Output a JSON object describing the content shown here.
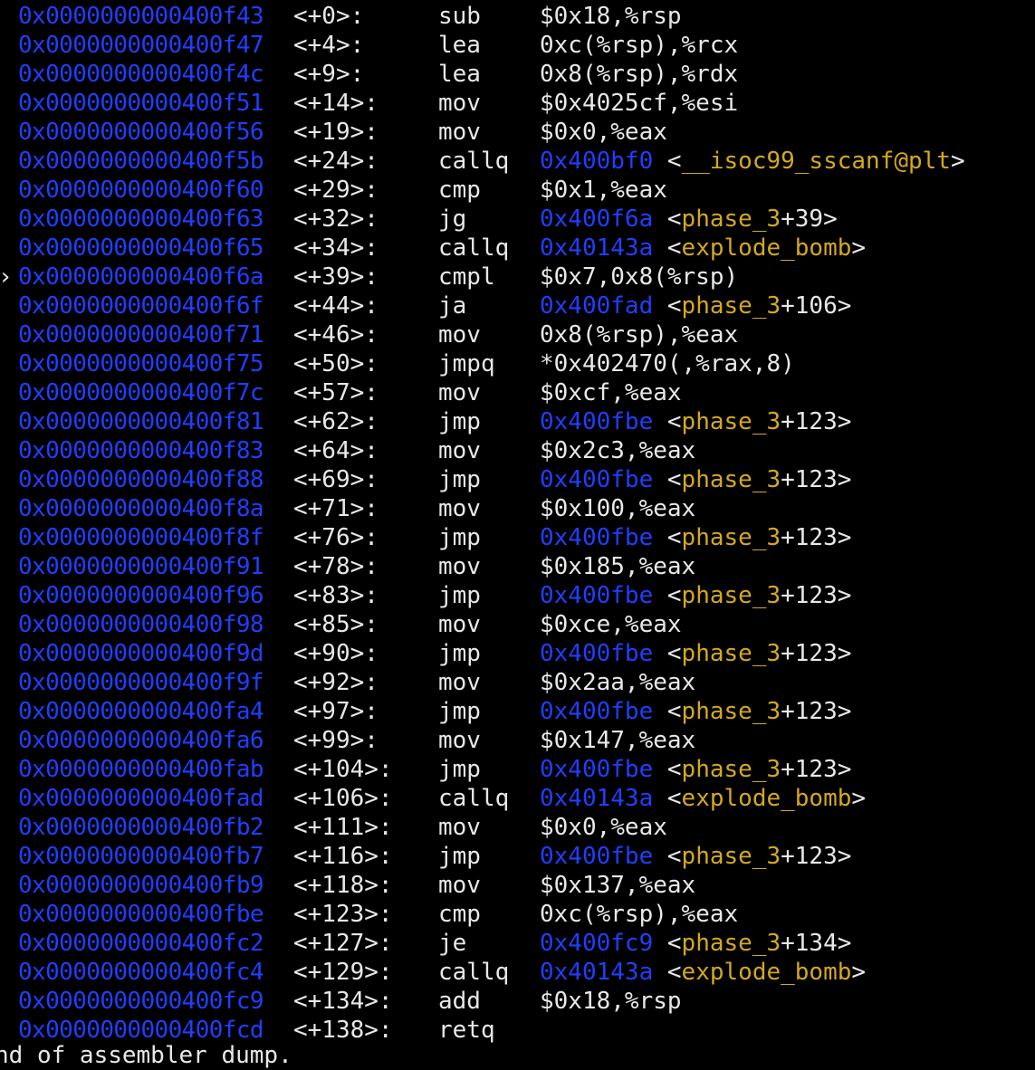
{
  "terminal": {
    "colors": {
      "background": "#000000",
      "text": "#e8e8e8",
      "address": "#1f3fff",
      "symbol": "#d4a820"
    },
    "current_marker": "›",
    "lines": [
      {
        "addr": "0x0000000000400f43",
        "off": "<+0>:",
        "mn": "sub",
        "ops": "$0x18,%rsp"
      },
      {
        "addr": "0x0000000000400f47",
        "off": "<+4>:",
        "mn": "lea",
        "ops": "0xc(%rsp),%rcx"
      },
      {
        "addr": "0x0000000000400f4c",
        "off": "<+9>:",
        "mn": "lea",
        "ops": "0x8(%rsp),%rdx"
      },
      {
        "addr": "0x0000000000400f51",
        "off": "<+14>:",
        "mn": "mov",
        "ops": "$0x4025cf,%esi"
      },
      {
        "addr": "0x0000000000400f56",
        "off": "<+19>:",
        "mn": "mov",
        "ops": "$0x0,%eax"
      },
      {
        "addr": "0x0000000000400f5b",
        "off": "<+24>:",
        "mn": "callq",
        "target": "0x400bf0",
        "sym_open": "<",
        "sym": "__isoc99_sscanf@plt",
        "sym_suffix": ">"
      },
      {
        "addr": "0x0000000000400f60",
        "off": "<+29>:",
        "mn": "cmp",
        "ops": "$0x1,%eax"
      },
      {
        "addr": "0x0000000000400f63",
        "off": "<+32>:",
        "mn": "jg",
        "target": "0x400f6a",
        "sym_open": "<",
        "sym": "phase_3",
        "sym_suffix": "+39>"
      },
      {
        "addr": "0x0000000000400f65",
        "off": "<+34>:",
        "mn": "callq",
        "target": "0x40143a",
        "sym_open": "<",
        "sym": "explode_bomb",
        "sym_suffix": ">"
      },
      {
        "addr": "0x0000000000400f6a",
        "off": "<+39>:",
        "mn": "cmpl",
        "ops": "$0x7,0x8(%rsp)",
        "current": true
      },
      {
        "addr": "0x0000000000400f6f",
        "off": "<+44>:",
        "mn": "ja",
        "target": "0x400fad",
        "sym_open": "<",
        "sym": "phase_3",
        "sym_suffix": "+106>"
      },
      {
        "addr": "0x0000000000400f71",
        "off": "<+46>:",
        "mn": "mov",
        "ops": "0x8(%rsp),%eax"
      },
      {
        "addr": "0x0000000000400f75",
        "off": "<+50>:",
        "mn": "jmpq",
        "ops": "*0x402470(,%rax,8)"
      },
      {
        "addr": "0x0000000000400f7c",
        "off": "<+57>:",
        "mn": "mov",
        "ops": "$0xcf,%eax"
      },
      {
        "addr": "0x0000000000400f81",
        "off": "<+62>:",
        "mn": "jmp",
        "target": "0x400fbe",
        "sym_open": "<",
        "sym": "phase_3",
        "sym_suffix": "+123>"
      },
      {
        "addr": "0x0000000000400f83",
        "off": "<+64>:",
        "mn": "mov",
        "ops": "$0x2c3,%eax"
      },
      {
        "addr": "0x0000000000400f88",
        "off": "<+69>:",
        "mn": "jmp",
        "target": "0x400fbe",
        "sym_open": "<",
        "sym": "phase_3",
        "sym_suffix": "+123>"
      },
      {
        "addr": "0x0000000000400f8a",
        "off": "<+71>:",
        "mn": "mov",
        "ops": "$0x100,%eax"
      },
      {
        "addr": "0x0000000000400f8f",
        "off": "<+76>:",
        "mn": "jmp",
        "target": "0x400fbe",
        "sym_open": "<",
        "sym": "phase_3",
        "sym_suffix": "+123>"
      },
      {
        "addr": "0x0000000000400f91",
        "off": "<+78>:",
        "mn": "mov",
        "ops": "$0x185,%eax"
      },
      {
        "addr": "0x0000000000400f96",
        "off": "<+83>:",
        "mn": "jmp",
        "target": "0x400fbe",
        "sym_open": "<",
        "sym": "phase_3",
        "sym_suffix": "+123>"
      },
      {
        "addr": "0x0000000000400f98",
        "off": "<+85>:",
        "mn": "mov",
        "ops": "$0xce,%eax"
      },
      {
        "addr": "0x0000000000400f9d",
        "off": "<+90>:",
        "mn": "jmp",
        "target": "0x400fbe",
        "sym_open": "<",
        "sym": "phase_3",
        "sym_suffix": "+123>"
      },
      {
        "addr": "0x0000000000400f9f",
        "off": "<+92>:",
        "mn": "mov",
        "ops": "$0x2aa,%eax"
      },
      {
        "addr": "0x0000000000400fa4",
        "off": "<+97>:",
        "mn": "jmp",
        "target": "0x400fbe",
        "sym_open": "<",
        "sym": "phase_3",
        "sym_suffix": "+123>"
      },
      {
        "addr": "0x0000000000400fa6",
        "off": "<+99>:",
        "mn": "mov",
        "ops": "$0x147,%eax"
      },
      {
        "addr": "0x0000000000400fab",
        "off": "<+104>:",
        "mn": "jmp",
        "target": "0x400fbe",
        "sym_open": "<",
        "sym": "phase_3",
        "sym_suffix": "+123>"
      },
      {
        "addr": "0x0000000000400fad",
        "off": "<+106>:",
        "mn": "callq",
        "target": "0x40143a",
        "sym_open": "<",
        "sym": "explode_bomb",
        "sym_suffix": ">"
      },
      {
        "addr": "0x0000000000400fb2",
        "off": "<+111>:",
        "mn": "mov",
        "ops": "$0x0,%eax"
      },
      {
        "addr": "0x0000000000400fb7",
        "off": "<+116>:",
        "mn": "jmp",
        "target": "0x400fbe",
        "sym_open": "<",
        "sym": "phase_3",
        "sym_suffix": "+123>"
      },
      {
        "addr": "0x0000000000400fb9",
        "off": "<+118>:",
        "mn": "mov",
        "ops": "$0x137,%eax"
      },
      {
        "addr": "0x0000000000400fbe",
        "off": "<+123>:",
        "mn": "cmp",
        "ops": "0xc(%rsp),%eax"
      },
      {
        "addr": "0x0000000000400fc2",
        "off": "<+127>:",
        "mn": "je",
        "target": "0x400fc9",
        "sym_open": "<",
        "sym": "phase_3",
        "sym_suffix": "+134>"
      },
      {
        "addr": "0x0000000000400fc4",
        "off": "<+129>:",
        "mn": "callq",
        "target": "0x40143a",
        "sym_open": "<",
        "sym": "explode_bomb",
        "sym_suffix": ">"
      },
      {
        "addr": "0x0000000000400fc9",
        "off": "<+134>:",
        "mn": "add",
        "ops": "$0x18,%rsp"
      },
      {
        "addr": "0x0000000000400fcd",
        "off": "<+138>:",
        "mn": "retq"
      }
    ],
    "footer": "nd of assembler dump."
  }
}
